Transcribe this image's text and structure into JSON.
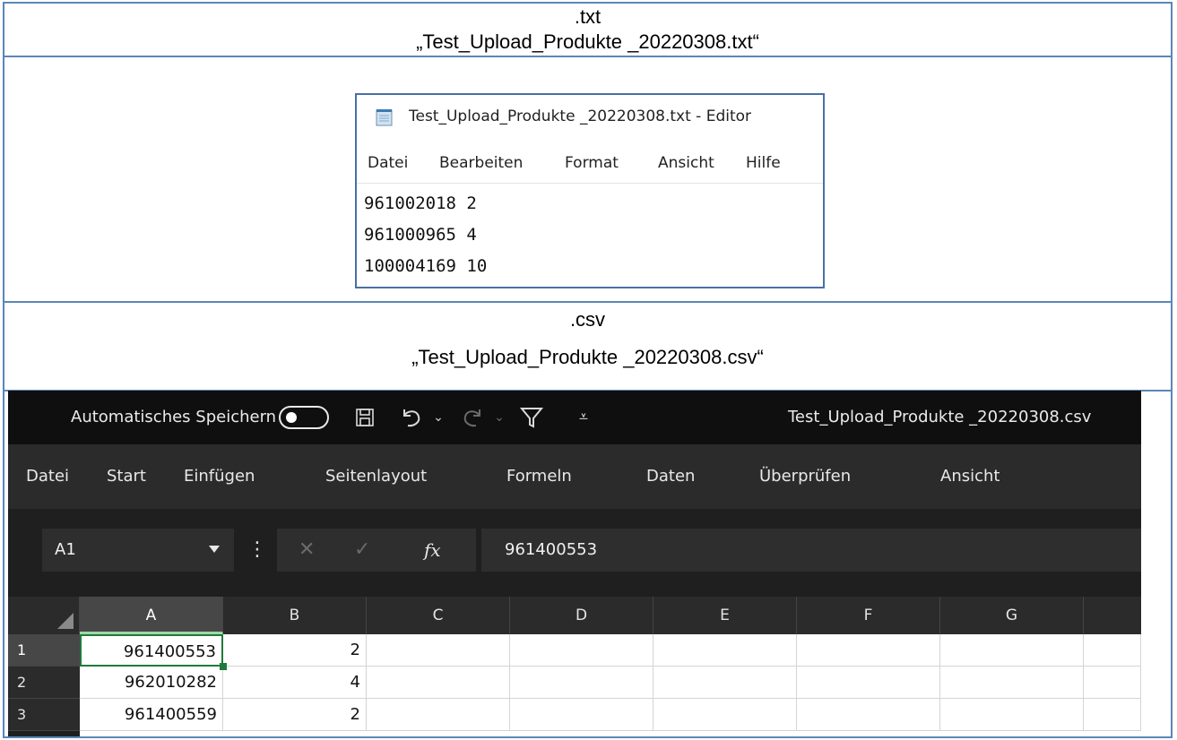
{
  "txt_section": {
    "heading": ".txt",
    "filename": "„Test_Upload_Produkte _20220308.txt“"
  },
  "notepad": {
    "title": "Test_Upload_Produkte _20220308.txt - Editor",
    "menu": [
      "Datei",
      "Bearbeiten",
      "Format",
      "Ansicht",
      "Hilfe"
    ],
    "lines": [
      "961002018 2",
      "961000965 4",
      "100004169 10"
    ]
  },
  "csv_section": {
    "heading": ".csv",
    "filename": "„Test_Upload_Produkte _20220308.csv“"
  },
  "excel": {
    "autosave_label": "Automatisches Speichern",
    "file_title": "Test_Upload_Produkte _20220308.csv",
    "ribbon_tabs": [
      "Datei",
      "Start",
      "Einfügen",
      "Seitenlayout",
      "Formeln",
      "Daten",
      "Überprüfen",
      "Ansicht"
    ],
    "name_box": "A1",
    "formula_value": "961400553",
    "fx_label": "fx",
    "columns": [
      "A",
      "B",
      "C",
      "D",
      "E",
      "F",
      "G"
    ],
    "rows": [
      {
        "num": "1",
        "a": "961400553",
        "b": "2"
      },
      {
        "num": "2",
        "a": "962010282",
        "b": "4"
      },
      {
        "num": "3",
        "a": "961400559",
        "b": "2"
      }
    ]
  },
  "colors": {
    "table_border": "#5b86b8",
    "excel_dark": "#1f1f1f",
    "excel_accent": "#1f7a3a"
  }
}
